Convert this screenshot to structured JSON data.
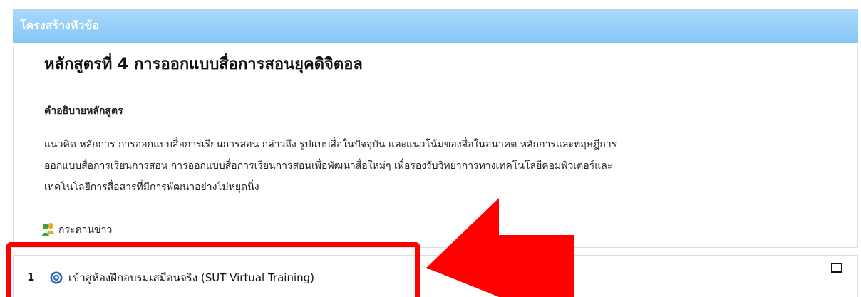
{
  "header": {
    "title": "โครงสร้างหัวข้อ"
  },
  "summary": {
    "course_title": "หลักสูตรที่ 4 การออกแบบสื่อการสอนยุคดิจิตอล",
    "description_heading": "คำอธิบายหลักสูตร",
    "description_lines": [
      "แนวคิด หลักการ การออกแบบสื่อการเรียนการสอน กล่าวถึง รูปแบบสื่อในปัจจุบัน และแนวโน้มของสื่อในอนาคต หลักการและทฤษฎีการ",
      "ออกแบบสื่อการเรียนการสอน การออกแบบสื่อการเรียนการสอนเพื่อพัฒนาสื่อใหม่ๆ เพื่อรองรับวิทยาการทางเทคโนโลยีคอมพิวเตอร์และ",
      "เทคโนโลยีการสื่อสารที่มีการพัฒนาอย่างไม่หยุดนิ่ง"
    ],
    "news_forum_label": "กระดานข่าว"
  },
  "section": {
    "number": "1",
    "activity_label": "เข้าสู่ห้องฝึกอบรมเสมือนจริง (SUT Virtual Training)"
  },
  "annotation": {
    "color": "#ff0000"
  },
  "icons": {
    "news": "forum-people-icon",
    "activity": "activity-circle-icon",
    "checkbox": "completion-checkbox"
  }
}
